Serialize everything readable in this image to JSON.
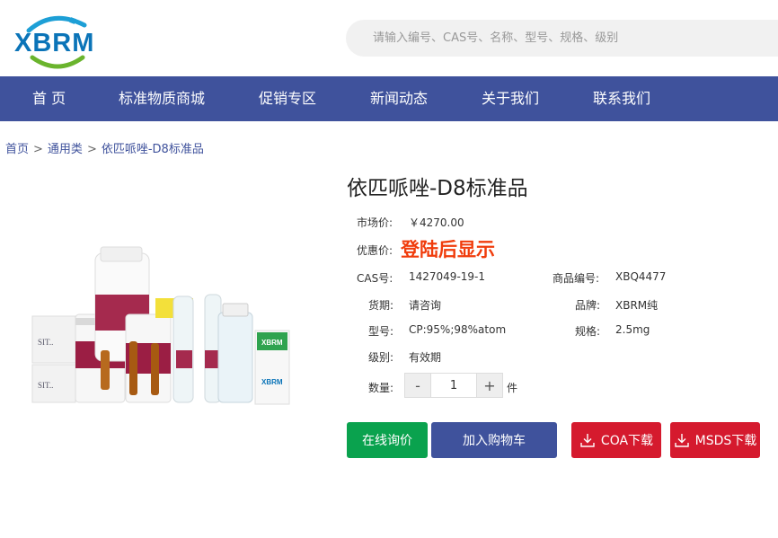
{
  "header": {
    "logo_text": "XBRM",
    "search_placeholder": "请输入编号、CAS号、名称、型号、规格、级别"
  },
  "nav": {
    "items": [
      "首 页",
      "标准物质商城",
      "促销专区",
      "新闻动态",
      "关于我们",
      "联系我们"
    ]
  },
  "breadcrumb": {
    "items": [
      "首页",
      "通用类",
      "依匹哌唑-D8标准品"
    ],
    "separator": ">"
  },
  "product": {
    "title": "依匹哌唑-D8标准品",
    "market_price_label": "市场价:",
    "market_price": "￥4270.00",
    "discount_label": "优惠价:",
    "discount_value": "登陆后显示",
    "cas_label": "CAS号:",
    "cas": "1427049-19-1",
    "code_label": "商品编号:",
    "code": "XBQ4477",
    "delivery_label": "货期:",
    "delivery": "请咨询",
    "brand_label": "品牌:",
    "brand": "XBRM纯",
    "model_label": "型号:",
    "model": "CP:95%;98%atom",
    "spec_label": "规格:",
    "spec": "2.5mg",
    "grade_label": "级别:",
    "grade": "有效期",
    "qty_label": "数量:",
    "qty_value": "1",
    "qty_unit": "件",
    "minus": "-",
    "plus": "+"
  },
  "actions": {
    "inquiry": "在线询价",
    "add_cart": "加入购物车",
    "coa": "COA下载",
    "msds": "MSDS下载"
  },
  "colors": {
    "nav_bg": "#3f529c",
    "inquiry_bg": "#0aa24e",
    "cart_bg": "#3f529c",
    "download_bg": "#d51a2e",
    "price_red": "#f03c0c"
  }
}
